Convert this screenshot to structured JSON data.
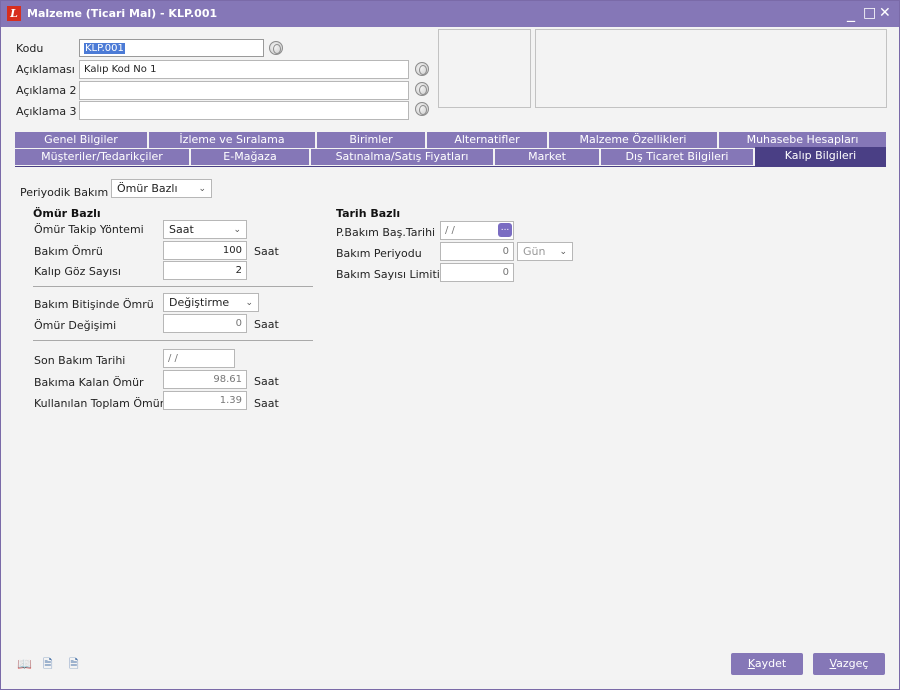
{
  "window": {
    "title": "Malzeme (Ticari Mal) - KLP.001",
    "logo_letter": "L",
    "minimize_glyph": "_",
    "maximize_glyph": "□",
    "close_glyph": "✕"
  },
  "header": {
    "kodu_label": "Kodu",
    "kodu_value": "KLP.001",
    "aciklamasi_label": "Açıklaması",
    "aciklamasi_value": "Kalıp Kod No 1",
    "aciklama2_label": "Açıklama 2",
    "aciklama2_value": "",
    "aciklama3_label": "Açıklama 3",
    "aciklama3_value": ""
  },
  "tabs_row1": [
    {
      "label": "Genel Bilgiler"
    },
    {
      "label": "İzleme ve Sıralama"
    },
    {
      "label": "Birimler"
    },
    {
      "label": "Alternatifler"
    },
    {
      "label": "Malzeme Özellikleri"
    },
    {
      "label": "Muhasebe Hesapları"
    }
  ],
  "tabs_row2": [
    {
      "label": "Müşteriler/Tedarikçiler"
    },
    {
      "label": "E-Mağaza"
    },
    {
      "label": "Satınalma/Satış Fiyatları"
    },
    {
      "label": "Market"
    },
    {
      "label": "Dış Ticaret Bilgileri"
    },
    {
      "label": "Kalıp Bilgileri"
    }
  ],
  "periyodik": {
    "label": "Periyodik Bakım",
    "value": "Ömür Bazlı"
  },
  "omur": {
    "title": "Ömür Bazlı",
    "takip_label": "Ömür Takip Yöntemi",
    "takip_value": "Saat",
    "bakim_omru_label": "Bakım Ömrü",
    "bakim_omru_value": "100",
    "bakim_omru_unit": "Saat",
    "goz_label": "Kalıp Göz Sayısı",
    "goz_value": "2",
    "bitis_label": "Bakım Bitişinde Ömrü",
    "bitis_value": "Değiştirme",
    "degisim_label": "Ömür Değişimi",
    "degisim_value": "0",
    "degisim_unit": "Saat",
    "son_bakim_label": "Son Bakım Tarihi",
    "son_bakim_value": "/ /",
    "kalan_label": "Bakıma Kalan Ömür",
    "kalan_value": "98.61",
    "kalan_unit": "Saat",
    "toplam_label": "Kullanılan Toplam Ömür",
    "toplam_value": "1.39",
    "toplam_unit": "Saat"
  },
  "tarih": {
    "title": "Tarih Bazlı",
    "bas_label": "P.Bakım Baş.Tarihi",
    "bas_value": "/ /",
    "dots": "...",
    "periyot_label": "Bakım Periyodu",
    "periyot_value": "0",
    "periyot_unit": "Gün",
    "limit_label": "Bakım Sayısı Limiti",
    "limit_value": "0"
  },
  "footer": {
    "save_label_pre": "K",
    "save_label_post": "aydet",
    "cancel_label_pre": "V",
    "cancel_label_post": "azgeç"
  }
}
